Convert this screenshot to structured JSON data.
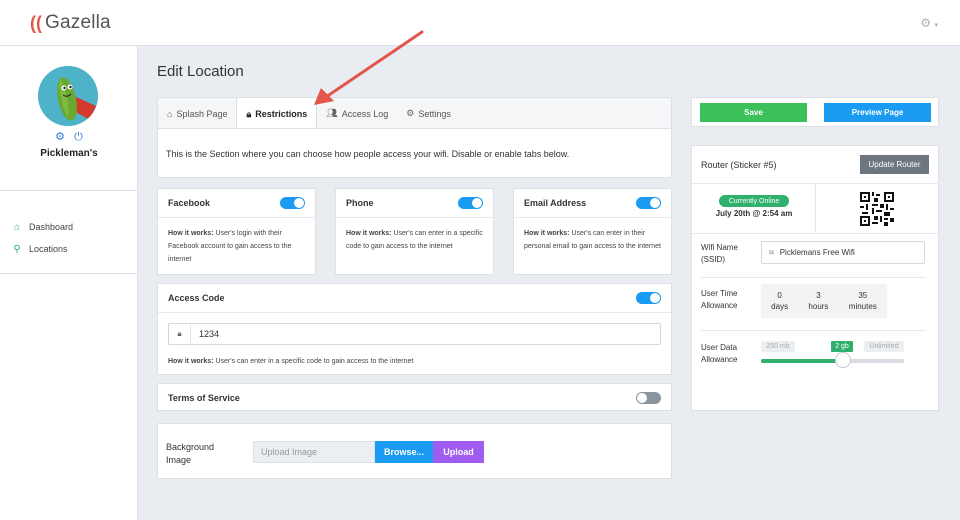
{
  "app": {
    "logo_text": "Gazella"
  },
  "sidebar": {
    "profile_name": "Pickleman's",
    "nav": [
      {
        "label": "Dashboard",
        "icon": "home-icon"
      },
      {
        "label": "Locations",
        "icon": "map-pin-icon"
      }
    ]
  },
  "page": {
    "title": "Edit Location"
  },
  "tabs": [
    {
      "label": "Splash Page",
      "icon": "home-icon",
      "active": false
    },
    {
      "label": "Restrictions",
      "icon": "lock-icon",
      "active": true
    },
    {
      "label": "Access Log",
      "icon": "users-icon",
      "active": false
    },
    {
      "label": "Settings",
      "icon": "gear-icon",
      "active": false
    }
  ],
  "intro": "This is the Section where you can choose how people access your wifi. Disable or enable tabs below.",
  "how_label": "How it works:",
  "options": [
    {
      "title": "Facebook",
      "enabled": true,
      "desc": "User's login with their Facebook account to gain access to the internet"
    },
    {
      "title": "Phone",
      "enabled": true,
      "desc": "User's can enter in a specific code to gain access to the internet"
    },
    {
      "title": "Email Address",
      "enabled": true,
      "desc": "User's can enter in their personal email to gain access to the internet"
    }
  ],
  "access_code": {
    "title": "Access Code",
    "enabled": true,
    "value": "1234",
    "desc": "User's can enter in a specific code to gain access to the internet"
  },
  "terms": {
    "title": "Terms of Service",
    "enabled": false
  },
  "background": {
    "label_line1": "Background",
    "label_line2": "Image",
    "placeholder": "Upload Image",
    "browse_label": "Browse...",
    "upload_label": "Upload"
  },
  "actions": {
    "save_label": "Save",
    "preview_label": "Preview Page"
  },
  "router": {
    "title": "Router (Sticker #5)",
    "update_label": "Update Router",
    "status": "Currently Online",
    "date": "July 20th @ 2:54 am",
    "wifi_label_1": "Wifi Name",
    "wifi_label_2": "(SSID)",
    "ssid": "Picklemans Free Wifi",
    "time_label_1": "User Time",
    "time_label_2": "Allowance",
    "time": [
      {
        "value": "0",
        "unit": "days"
      },
      {
        "value": "3",
        "unit": "hours"
      },
      {
        "value": "35",
        "unit": "minutes"
      }
    ],
    "data_label_1": "User Data",
    "data_label_2": "Allowance",
    "data_options": [
      "250 mb",
      "2 gb",
      "Unlimited"
    ],
    "data_selected": "2 gb",
    "data_slider_fraction": 0.57
  },
  "colors": {
    "accent_blue": "#1a9af0",
    "save_green": "#3cc05a",
    "status_green": "#2fb06e",
    "upload_purple": "#a05cf0",
    "arrow_red": "#e2574c"
  }
}
